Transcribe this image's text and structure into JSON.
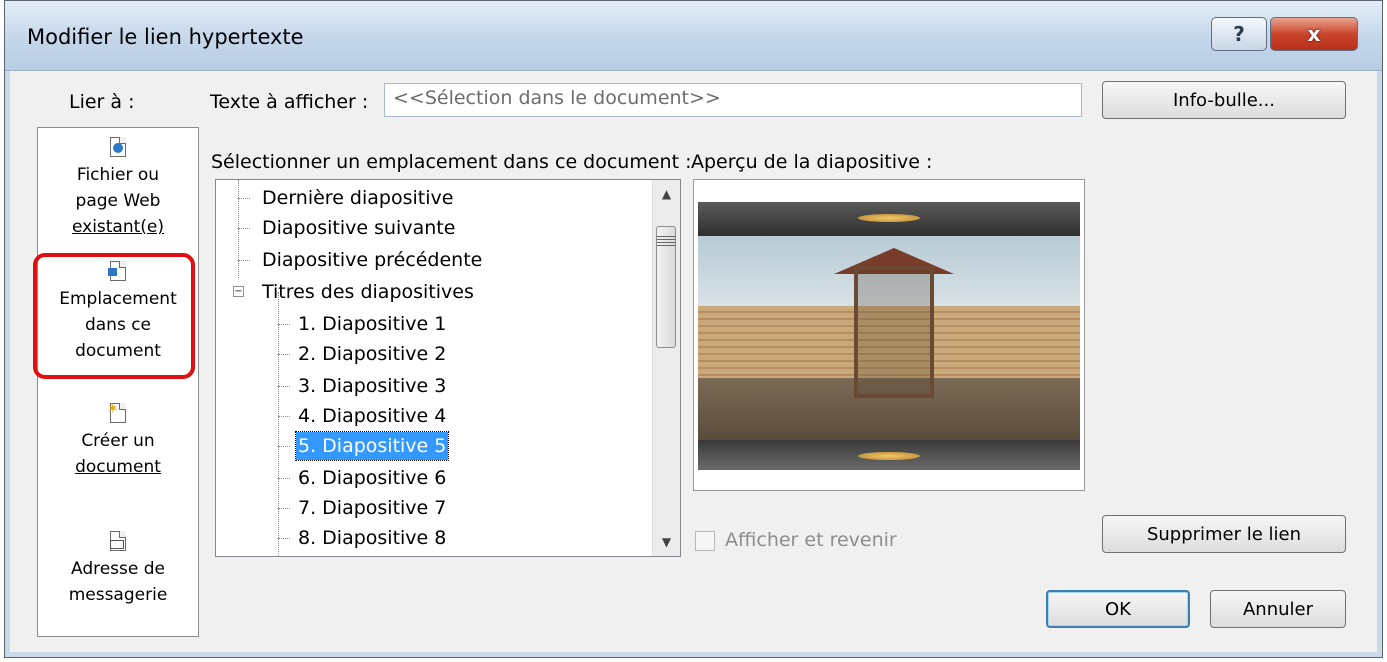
{
  "dialog": {
    "title": "Modifier le lien hypertexte",
    "help_label": "?",
    "close_label": "x"
  },
  "link_to": {
    "label": "Lier à :",
    "items": [
      {
        "l1": "Fichier ou",
        "l2": "page Web",
        "l3": "existant(e)"
      },
      {
        "l1": "Emplacement",
        "l2": "dans ce",
        "l3": "document"
      },
      {
        "l1": "Créer un",
        "l2": "document"
      },
      {
        "l1": "Adresse de",
        "l2": "messagerie"
      }
    ]
  },
  "text_display": {
    "label": "Texte à afficher :",
    "value": "<<Sélection dans le document>>"
  },
  "buttons": {
    "info_bulle": "Info-bulle...",
    "remove_link": "Supprimer le lien",
    "ok": "OK",
    "cancel": "Annuler"
  },
  "location": {
    "label": "Sélectionner un emplacement dans ce document :",
    "items": [
      "Dernière diapositive",
      "Diapositive suivante",
      "Diapositive précédente",
      "Titres des diapositives",
      "1. Diapositive 1",
      "2. Diapositive 2",
      "3. Diapositive 3",
      "4. Diapositive 4",
      "5. Diapositive 5",
      "6. Diapositive 6",
      "7. Diapositive 7",
      "8. Diapositive 8"
    ],
    "selected_index": 8
  },
  "preview": {
    "label": "Aperçu de la diapositive :",
    "show_and_return": "Afficher et revenir"
  },
  "colors": {
    "selection": "#3399ff",
    "highlight": "#e01010"
  }
}
